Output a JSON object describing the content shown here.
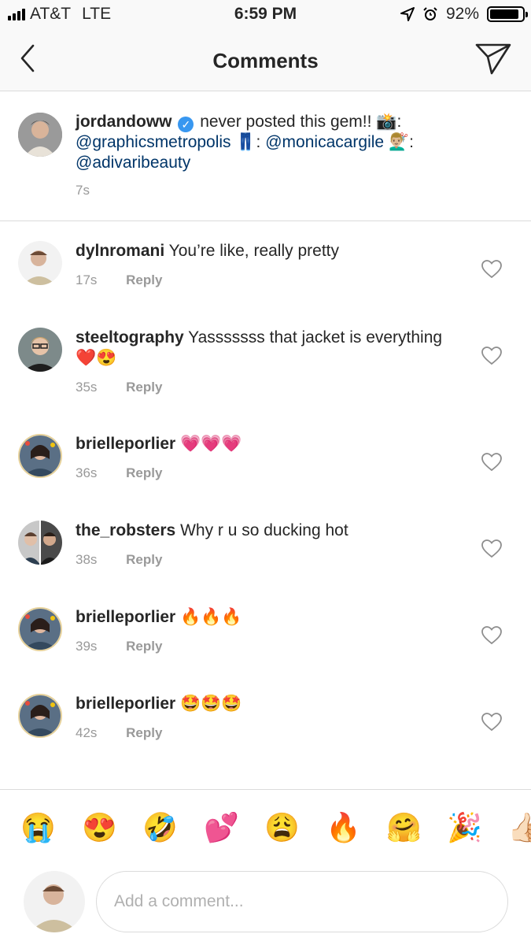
{
  "status_bar": {
    "carrier": "AT&T",
    "network": "LTE",
    "time": "6:59 PM",
    "battery": "92%"
  },
  "header": {
    "title": "Comments"
  },
  "caption": {
    "username": "jordandoww",
    "text_1": "never posted this gem!! 📸:",
    "mention_1": "@graphicsmetropolis",
    "text_2": "👖:",
    "mention_2": "@monicacargile",
    "text_3": "💇🏼‍♂️:",
    "mention_3": "@adivaribeauty",
    "time": "7s"
  },
  "comments": [
    {
      "username": "dylnromani",
      "text": "You’re like, really pretty",
      "time": "17s",
      "reply": "Reply"
    },
    {
      "username": "steeltography",
      "text": "Yasssssss that jacket is everything ❤️😍",
      "time": "35s",
      "reply": "Reply"
    },
    {
      "username": "brielleporlier",
      "text": "💗💗💗",
      "time": "36s",
      "reply": "Reply"
    },
    {
      "username": "the_robsters",
      "text": "Why r u so ducking hot",
      "time": "38s",
      "reply": "Reply"
    },
    {
      "username": "brielleporlier",
      "text": "🔥🔥🔥",
      "time": "39s",
      "reply": "Reply"
    },
    {
      "username": "brielleporlier",
      "text": "🤩🤩🤩",
      "time": "42s",
      "reply": "Reply"
    }
  ],
  "emoji_bar": [
    "😭",
    "😍",
    "🤣",
    "💕",
    "😩",
    "🔥",
    "🤗",
    "🎉",
    "👍🏻"
  ],
  "input": {
    "placeholder": "Add a comment..."
  },
  "colors": {
    "link": "#003569",
    "meta": "#999999",
    "divider": "#dbdbdb",
    "verified": "#3897f0"
  }
}
